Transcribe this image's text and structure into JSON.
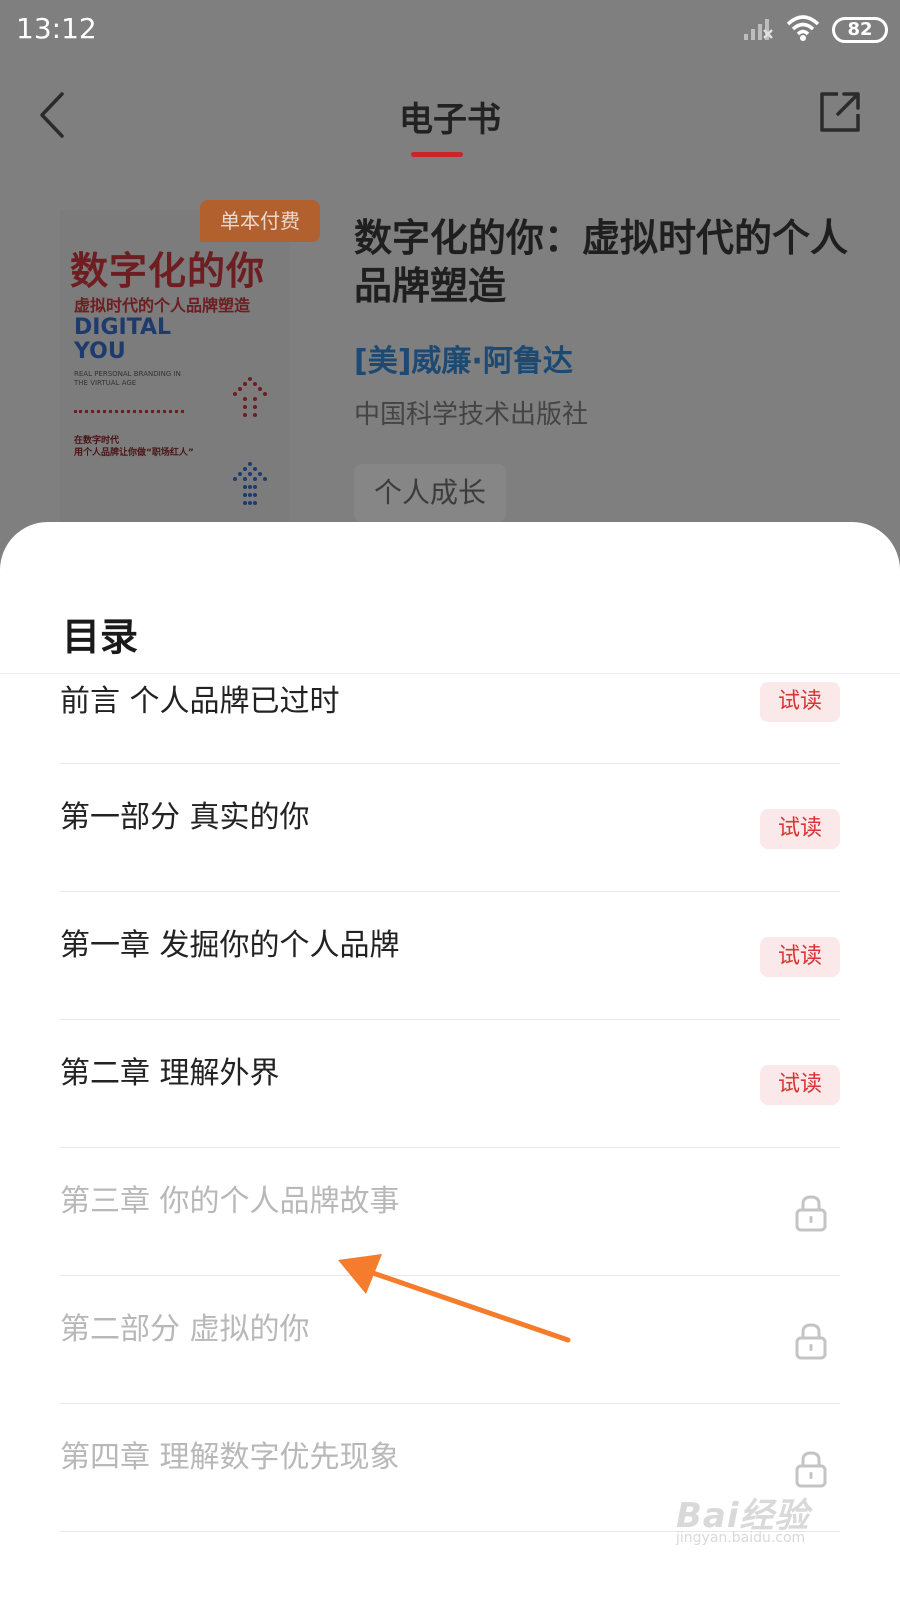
{
  "status_bar": {
    "time": "13:12",
    "battery": "82"
  },
  "header": {
    "title": "电子书"
  },
  "book": {
    "badge": "单本付费",
    "cover": {
      "title": "数字化的你",
      "subtitle": "虚拟时代的个人品牌塑造",
      "english_title_line1": "DIGITAL",
      "english_title_line2": "YOU",
      "english_subtitle": "REAL PERSONAL BRANDING IN THE VIRTUAL AGE",
      "slogan_line1": "在数字时代",
      "slogan_line2": "用个人品牌让你做“职场红人”"
    },
    "title": "数字化的你：虚拟时代的个人品牌塑造",
    "author": "[美]威廉·阿鲁达",
    "publisher": "中国科学技术出版社",
    "tag": "个人成长"
  },
  "toc": {
    "title": "目录",
    "trial_label": "试读",
    "items": [
      {
        "label": "前言 个人品牌已过时",
        "locked": false
      },
      {
        "label": "第一部分 真实的你",
        "locked": false
      },
      {
        "label": "第一章 发掘你的个人品牌",
        "locked": false
      },
      {
        "label": "第二章 理解外界",
        "locked": false
      },
      {
        "label": "第三章 你的个人品牌故事",
        "locked": true
      },
      {
        "label": "第二部分 虚拟的你",
        "locked": true
      },
      {
        "label": "第四章 理解数字优先现象",
        "locked": true
      }
    ]
  },
  "watermark": {
    "brand": "Bai经验",
    "url": "jingyan.baidu.com"
  },
  "colors": {
    "accent": "#c9252c",
    "trial_bg": "#fbe8e8",
    "annotation_arrow": "#f47c2c"
  }
}
